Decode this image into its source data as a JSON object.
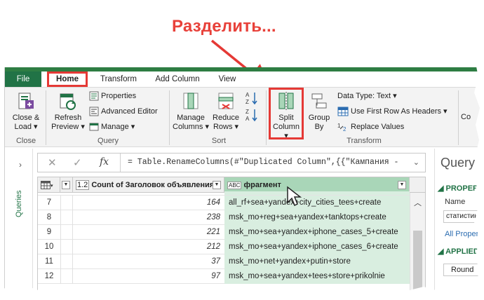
{
  "callout": "Разделить...",
  "colors": {
    "accent_red": "#e53935",
    "excel_green": "#217346",
    "selected_column": "#a9d6b8"
  },
  "tabs": [
    {
      "label": "File"
    },
    {
      "label": "Home"
    },
    {
      "label": "Transform"
    },
    {
      "label": "Add Column"
    },
    {
      "label": "View"
    }
  ],
  "ribbon": {
    "close": {
      "btn_line1": "Close &",
      "btn_line2": "Load ▾",
      "group": "Close"
    },
    "query": {
      "refresh_line1": "Refresh",
      "refresh_line2": "Preview ▾",
      "properties": "Properties",
      "advanced_editor": "Advanced Editor",
      "manage": "Manage ▾",
      "group": "Query"
    },
    "manage_columns": {
      "line1": "Manage",
      "line2": "Columns ▾"
    },
    "reduce_rows": {
      "line1": "Reduce",
      "line2": "Rows ▾"
    },
    "sort": {
      "group": "Sort"
    },
    "split_column": {
      "line1": "Split",
      "line2": "Column ▾"
    },
    "group_by": {
      "line1": "Group",
      "line2": "By"
    },
    "transform": {
      "data_type": "Data Type: Text ▾",
      "first_row": "Use First Row As Headers ▾",
      "replace_values": "Replace Values",
      "group": "Transform"
    },
    "cut_off": "Co"
  },
  "queries_pane": {
    "chevron": "›",
    "label": "Queries"
  },
  "formula_bar": {
    "cancel": "✕",
    "confirm": "✓",
    "fx": "fx",
    "formula": "= Table.RenameColumns(#\"Duplicated Column\",{{\"Кампания -",
    "expand": "⌄"
  },
  "grid": {
    "headers": {
      "type_count": "1.2",
      "count": "Count of Заголовок объявления",
      "type_frag": "ABC",
      "fragment": "фрагмент"
    },
    "rows": [
      {
        "n": "7",
        "count": "164",
        "frag": "all_rf+sea+yandex+city_cities_tees+create"
      },
      {
        "n": "8",
        "count": "238",
        "frag": "msk_mo+reg+sea+yandex+tanktops+create"
      },
      {
        "n": "9",
        "count": "221",
        "frag": "msk_mo+sea+yandex+iphone_cases_5+create"
      },
      {
        "n": "10",
        "count": "212",
        "frag": "msk_mo+sea+yandex+iphone_cases_6+create"
      },
      {
        "n": "11",
        "count": "37",
        "frag": "msk_mo+net+yandex+putin+store"
      },
      {
        "n": "12",
        "count": "97",
        "frag": "msk_mo+sea+yandex+tees+store+prikolnie"
      }
    ]
  },
  "query_settings": {
    "title": "Query S",
    "properties_sec": "PROPERTIES",
    "name_label": "Name",
    "name_value": "статистика",
    "all_props": "All Properties",
    "applied_sec": "APPLIED STEPS",
    "step": "Round"
  }
}
